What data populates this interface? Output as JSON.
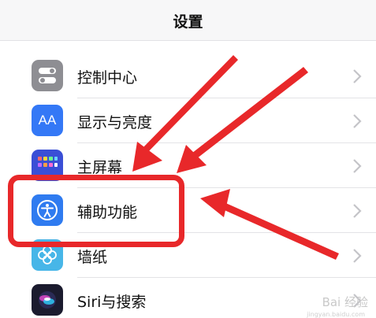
{
  "nav": {
    "title": "设置"
  },
  "rows": [
    {
      "label": "控制中心",
      "icon": "control-center-icon",
      "color": "#8e8e93"
    },
    {
      "label": "显示与亮度",
      "icon": "display-brightness-icon",
      "color": "#3478f6",
      "glyph": "AA"
    },
    {
      "label": "主屏幕",
      "icon": "home-screen-icon",
      "color": "#3a4fd6"
    },
    {
      "label": "辅助功能",
      "icon": "accessibility-icon",
      "color": "#2f7bf0"
    },
    {
      "label": "墙纸",
      "icon": "wallpaper-icon",
      "color": "#47b6e8"
    },
    {
      "label": "Siri与搜索",
      "icon": "siri-icon",
      "color": "#1b1b2e"
    }
  ],
  "annotation": {
    "highlight_color": "#e8282a"
  },
  "watermark": {
    "text": "Bai 经验",
    "sub": "jingyan.baidu.com"
  }
}
